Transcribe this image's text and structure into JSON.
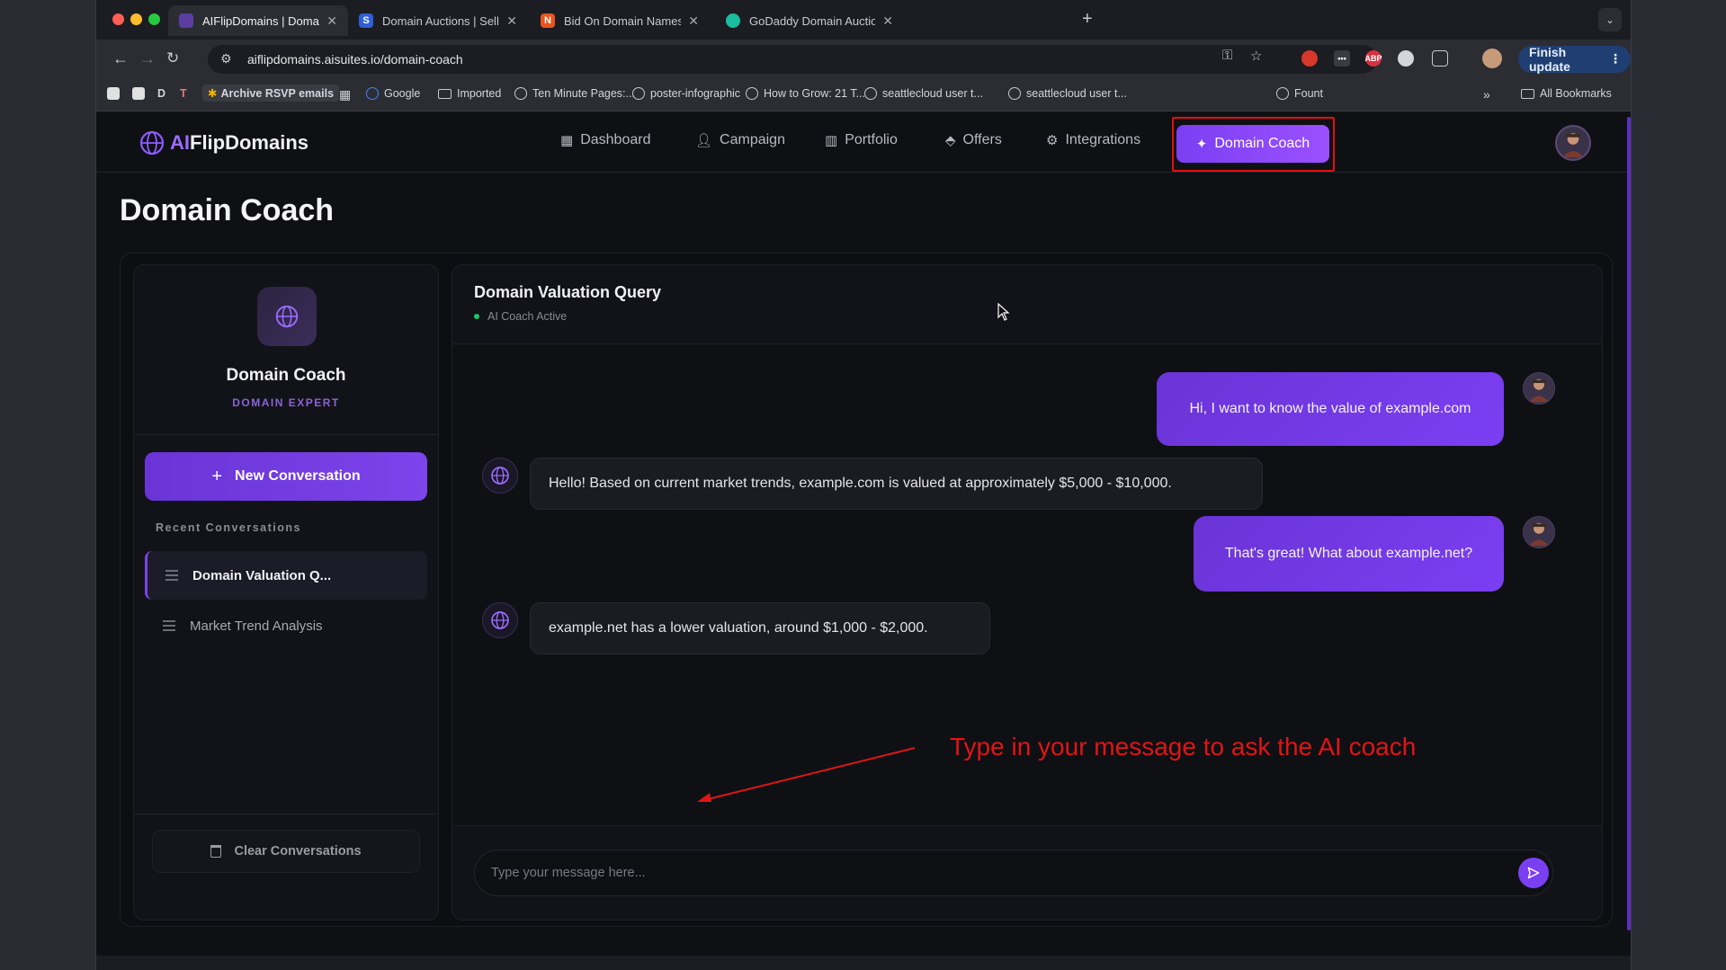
{
  "browser": {
    "tabs": [
      {
        "title": "AIFlipDomains | Domain Coac",
        "active": true,
        "favicon_color": "#5a3fa0"
      },
      {
        "title": "Domain Auctions | Sell domai",
        "active": false,
        "favicon_color": "#2f5fd6",
        "favicon_letter": "S"
      },
      {
        "title": "Bid On Domain Names | Dom",
        "active": false,
        "favicon_color": "#e8551f",
        "favicon_letter": "N"
      },
      {
        "title": "GoDaddy Domain Auctions",
        "active": false,
        "favicon_color": "#1bbca0"
      }
    ],
    "url": "aiflipdomains.aisuites.io/domain-coach",
    "finish_update_label": "Finish update",
    "bookmarks": [
      {
        "label": "D"
      },
      {
        "label": "T"
      },
      {
        "label": "Archive RSVP emails"
      },
      {
        "label": "Google"
      },
      {
        "label": "Imported"
      },
      {
        "label": "Ten Minute Pages:..."
      },
      {
        "label": "poster-infographic"
      },
      {
        "label": "How to Grow: 21 T..."
      },
      {
        "label": "seattlecloud user t..."
      },
      {
        "label": "seattlecloud user t..."
      },
      {
        "label": "Fount"
      }
    ],
    "overflow_label": "»",
    "all_bookmarks_label": "All Bookmarks"
  },
  "app": {
    "logo_ai": "AI",
    "logo_rest": "FlipDomains",
    "nav": [
      {
        "label": "Dashboard",
        "icon": "grid-icon"
      },
      {
        "label": "Campaign",
        "icon": "person-icon"
      },
      {
        "label": "Portfolio",
        "icon": "building-icon"
      },
      {
        "label": "Offers",
        "icon": "tag-icon"
      },
      {
        "label": "Integrations",
        "icon": "gear-icon"
      }
    ],
    "nav_active": {
      "label": "Domain Coach",
      "icon": "wand-icon"
    },
    "accent_color": "#7b3ff2"
  },
  "page": {
    "title": "Domain Coach"
  },
  "sidebar": {
    "title": "Domain Coach",
    "subtitle": "DOMAIN EXPERT",
    "new_conversation_label": "New Conversation",
    "recent_label": "Recent Conversations",
    "conversations": [
      {
        "label": "Domain Valuation Q...",
        "active": true
      },
      {
        "label": "Market Trend Analysis",
        "active": false
      }
    ],
    "clear_label": "Clear Conversations"
  },
  "chat": {
    "title": "Domain Valuation Query",
    "status": "AI Coach Active",
    "messages": [
      {
        "role": "user",
        "text": "Hi, I want to know the value of example.com"
      },
      {
        "role": "ai",
        "text": "Hello! Based on current market trends, example.com is valued at approximately $5,000 - $10,000."
      },
      {
        "role": "user",
        "text": "That's great! What about example.net?"
      },
      {
        "role": "ai",
        "text": "example.net has a lower valuation, around $1,000 - $2,000."
      }
    ],
    "input_placeholder": "Type your message here...",
    "input_value": ""
  },
  "annotation": {
    "text": "Type in your message to ask the AI coach",
    "color": "#e01515"
  }
}
